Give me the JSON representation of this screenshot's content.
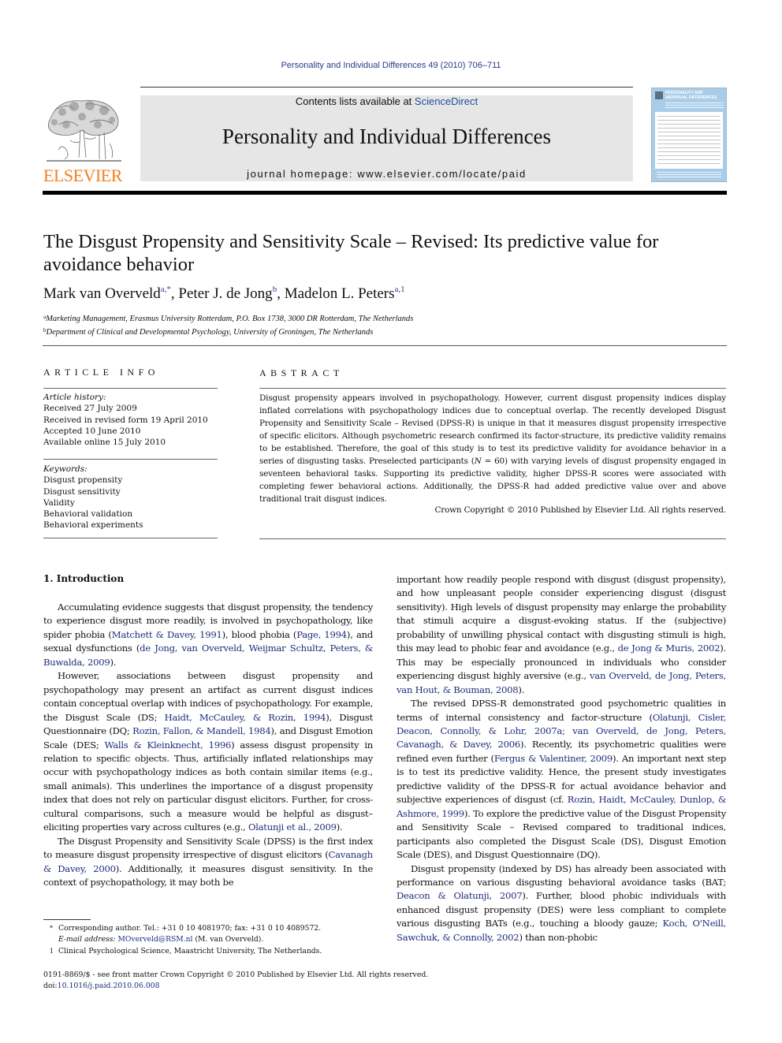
{
  "running_head": "Personality and Individual Differences 49 (2010) 706–711",
  "publisher": {
    "logo_icon": "elsevier-tree-icon",
    "name": "ELSEVIER",
    "brand_color": "#f07f1e"
  },
  "masthead": {
    "contents_prefix": "Contents lists available at ",
    "contents_link": "ScienceDirect",
    "journal_title": "Personality and Individual Differences",
    "homepage": "journal homepage: www.elsevier.com/locate/paid",
    "background": "#e6e6e6"
  },
  "cover": {
    "icon": "journal-cover-thumbnail",
    "title_line1": "PERSONALITY AND",
    "title_line2": "INDIVIDUAL DIFFERENCES"
  },
  "article": {
    "title": "The Disgust Propensity and Sensitivity Scale – Revised: Its predictive value for avoidance behavior",
    "authors": [
      {
        "name": "Mark van Overveld",
        "sup": "a,*"
      },
      {
        "name": "Peter J. de Jong",
        "sup": "b"
      },
      {
        "name": "Madelon L. Peters",
        "sup": "a,1"
      }
    ],
    "affiliations": [
      {
        "mark": "a",
        "text": "Marketing Management, Erasmus University Rotterdam, P.O. Box 1738, 3000 DR Rotterdam, The Netherlands"
      },
      {
        "mark": "b",
        "text": "Department of Clinical and Developmental Psychology, University of Groningen, The Netherlands"
      }
    ]
  },
  "article_info": {
    "heading": "ARTICLE INFO",
    "history_label": "Article history:",
    "history": [
      "Received 27 July 2009",
      "Received in revised form 19 April 2010",
      "Accepted 10 June 2010",
      "Available online 15 July 2010"
    ],
    "keywords_label": "Keywords:",
    "keywords": [
      "Disgust propensity",
      "Disgust sensitivity",
      "Validity",
      "Behavioral validation",
      "Behavioral experiments"
    ]
  },
  "abstract": {
    "heading": "ABSTRACT",
    "text_before_n": "Disgust propensity appears involved in psychopathology. However, current disgust propensity indices display inflated correlations with psychopathology indices due to conceptual overlap. The recently developed Disgust Propensity and Sensitivity Scale – Revised (DPSS-R) is unique in that it measures disgust propensity irrespective of specific elicitors. Although psychometric research confirmed its factor-structure, its predictive validity remains to be established. Therefore, the goal of this study is to test its predictive validity for avoidance behavior in a series of disgusting tasks. Preselected participants (",
    "n_symbol": "N",
    "n_value": " = 60)",
    "text_after_n": " with varying levels of disgust propensity engaged in seventeen behavioral tasks. Supporting its predictive validity, higher DPSS-R scores were associated with completing fewer behavioral actions. Additionally, the DPSS-R had added predictive value over and above traditional trait disgust indices.",
    "copyright": "Crown Copyright © 2010 Published by Elsevier Ltd. All rights reserved."
  },
  "body": {
    "section_heading": "1. Introduction",
    "left_column": [
      [
        {
          "t": "Accumulating evidence suggests that disgust propensity, the tendency to experience disgust more readily, is involved in psychopathology, like spider phobia ("
        },
        {
          "l": "Matchett & Davey, 1991"
        },
        {
          "t": "), blood phobia ("
        },
        {
          "l": "Page, 1994"
        },
        {
          "t": "), and sexual dysfunctions ("
        },
        {
          "l": "de Jong, van Overveld, Weijmar Schultz, Peters, & Buwalda, 2009"
        },
        {
          "t": ")."
        }
      ],
      [
        {
          "t": "However, associations between disgust propensity and psychopathology may present an artifact as current disgust indices contain conceptual overlap with indices of psychopathology. For example, the Disgust Scale (DS; "
        },
        {
          "l": "Haidt, McCauley, & Rozin, 1994"
        },
        {
          "t": "), Disgust Questionnaire (DQ; "
        },
        {
          "l": "Rozin, Fallon, & Mandell, 1984"
        },
        {
          "t": "), and Disgust Emotion Scale (DES; "
        },
        {
          "l": "Walls & Kleinknecht, 1996"
        },
        {
          "t": ") assess disgust propensity in relation to specific objects. Thus, artificially inflated relationships may occur with psychopathology indices as both contain similar items (e.g., small animals). This underlines the importance of a disgust propensity index that does not rely on particular disgust elicitors. Further, for cross-cultural comparisons, such a measure would be helpful as disgust–eliciting properties vary across cultures (e.g., "
        },
        {
          "l": "Olatunji et al., 2009"
        },
        {
          "t": ")."
        }
      ],
      [
        {
          "t": "The Disgust Propensity and Sensitivity Scale (DPSS) is the first index to measure disgust propensity irrespective of disgust elicitors ("
        },
        {
          "l": "Cavanagh & Davey, 2000"
        },
        {
          "t": "). Additionally, it measures disgust sensitivity. In the context of psychopathology, it may both be"
        }
      ]
    ],
    "right_column": [
      [
        {
          "t": "important how readily people respond with disgust (disgust propensity), and how unpleasant people consider experiencing disgust (disgust sensitivity). High levels of disgust propensity may enlarge the probability that stimuli acquire a disgust-evoking status. If the (subjective) probability of unwilling physical contact with disgusting stimuli is high, this may lead to phobic fear and avoidance (e.g., "
        },
        {
          "l": "de Jong & Muris, 2002"
        },
        {
          "t": "). This may be especially pronounced in individuals who consider experiencing disgust highly aversive (e.g., "
        },
        {
          "l": "van Overveld, de Jong, Peters, van Hout, & Bouman, 2008"
        },
        {
          "t": ")."
        }
      ],
      [
        {
          "t": "The revised DPSS-R demonstrated good psychometric qualities in terms of internal consistency and factor-structure ("
        },
        {
          "l": "Olatunji, Cisler, Deacon, Connolly, & Lohr, 2007a; van Overveld, de Jong, Peters, Cavanagh, & Davey, 2006"
        },
        {
          "t": "). Recently, its psychometric qualities were refined even further ("
        },
        {
          "l": "Fergus & Valentiner, 2009"
        },
        {
          "t": "). An important next step is to test its predictive validity. Hence, the present study investigates predictive validity of the DPSS-R for actual avoidance behavior and subjective experiences of disgust (cf. "
        },
        {
          "l": "Rozin, Haidt, McCauley, Dunlop, & Ashmore, 1999"
        },
        {
          "t": "). To explore the predictive value of the Disgust Propensity and Sensitivity Scale – Revised compared to traditional indices, participants also completed the Disgust Scale (DS), Disgust Emotion Scale (DES), and Disgust Questionnaire (DQ)."
        }
      ],
      [
        {
          "t": "Disgust propensity (indexed by DS) has already been associated with performance on various disgusting behavioral avoidance tasks (BAT; "
        },
        {
          "l": "Deacon & Olatunji, 2007"
        },
        {
          "t": "). Further, blood phobic individuals with enhanced disgust propensity (DES) were less compliant to complete various disgusting BATs (e.g., touching a bloody gauze; "
        },
        {
          "l": "Koch, O'Neill, Sawchuk, & Connolly, 2002"
        },
        {
          "t": ") than non-phobic"
        }
      ]
    ]
  },
  "footnotes": {
    "corresponding_mark": "*",
    "corresponding": "Corresponding author. Tel.: +31 0 10 4081970; fax: +31 0 10 4089572.",
    "email_label": "E-mail address: ",
    "email": "MOverveld@RSM.nl",
    "email_suffix": " (M. van Overveld).",
    "note1_mark": "1",
    "note1": "Clinical Psychological Science, Maastricht University, The Netherlands."
  },
  "bottom": {
    "issn_line": "0191-8869/$ - see front matter Crown Copyright © 2010 Published by Elsevier Ltd. All rights reserved.",
    "doi_label": "doi:",
    "doi": "10.1016/j.paid.2010.06.008"
  },
  "colors": {
    "link": "#1f2d7a",
    "sciencedirect": "#1f4d9c"
  }
}
